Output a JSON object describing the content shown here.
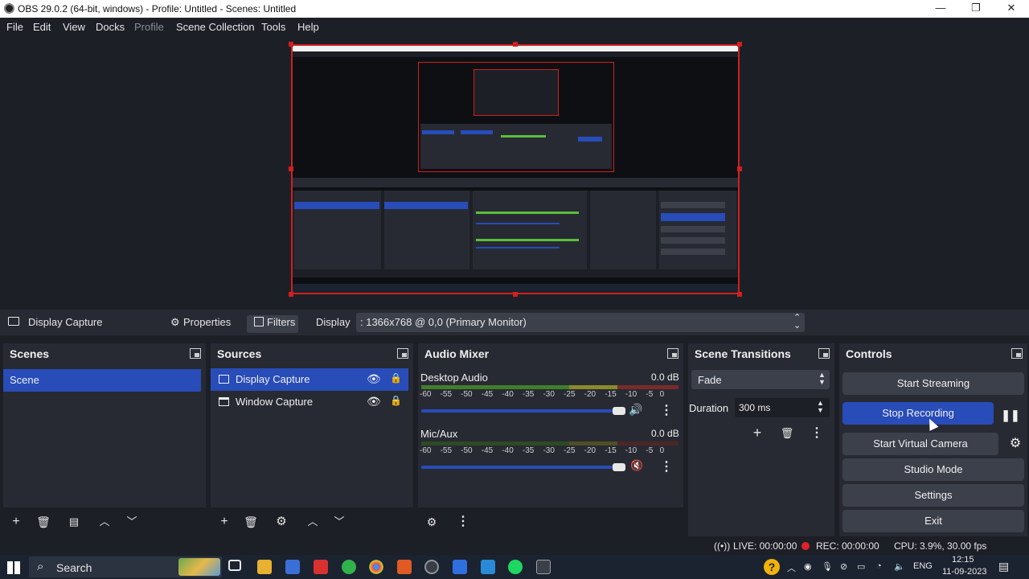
{
  "window": {
    "title": "OBS 29.0.2 (64-bit, windows) - Profile: Untitled - Scenes: Untitled",
    "min_glyph": "—",
    "restore_glyph": "❐",
    "close_glyph": "✕"
  },
  "menu": [
    "File",
    "Edit",
    "View",
    "Docks",
    "Profile",
    "Scene Collection",
    "Tools",
    "Help"
  ],
  "source_toolbar": {
    "source_name": "Display Capture",
    "properties_label": "Properties",
    "filters_label": "Filters",
    "display_label": "Display",
    "display_value": ": 1366x768 @ 0,0 (Primary Monitor)"
  },
  "scenes": {
    "title": "Scenes",
    "items": [
      "Scene"
    ]
  },
  "sources": {
    "title": "Sources",
    "items": [
      "Display Capture",
      "Window Capture"
    ]
  },
  "audio_mixer": {
    "title": "Audio Mixer",
    "channels": [
      {
        "name": "Desktop Audio",
        "level": "0.0 dB",
        "muted": false
      },
      {
        "name": "Mic/Aux",
        "level": "0.0 dB",
        "muted": true
      }
    ],
    "ticks": [
      "-60",
      "-55",
      "-50",
      "-45",
      "-40",
      "-35",
      "-30",
      "-25",
      "-20",
      "-15",
      "-10",
      "-5",
      "0"
    ]
  },
  "transitions": {
    "title": "Scene Transitions",
    "selected": "Fade",
    "duration_label": "Duration",
    "duration_value": "300 ms"
  },
  "controls": {
    "title": "Controls",
    "start_streaming": "Start Streaming",
    "stop_recording": "Stop Recording",
    "start_virtual_camera": "Start Virtual Camera",
    "studio_mode": "Studio Mode",
    "settings": "Settings",
    "exit": "Exit"
  },
  "status": {
    "live": "LIVE: 00:00:00",
    "rec": "REC: 00:00:00",
    "cpu": "CPU: 3.9%, 30.00 fps"
  },
  "taskbar": {
    "search_placeholder": "Search",
    "lang": "ENG",
    "time": "12:15",
    "date": "11-09-2023"
  },
  "colors": {
    "accent": "#284cb8",
    "record_red": "#e0212b",
    "panel": "#272a33",
    "background": "#1d1f26"
  }
}
